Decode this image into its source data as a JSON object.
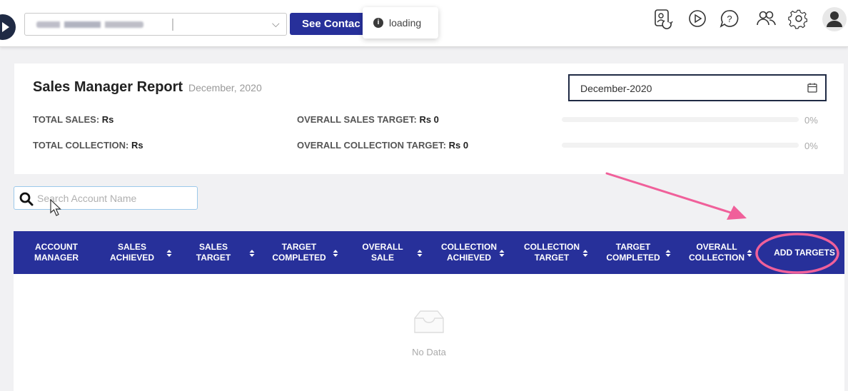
{
  "topbar": {
    "account_select": {
      "value_obscured": true
    },
    "see_button_label": "See Contac",
    "toast_text": "loading",
    "icons": [
      "refresh-contact-icon",
      "play-circle-icon",
      "help-chat-icon",
      "users-icon",
      "gear-icon",
      "user-avatar-icon"
    ]
  },
  "report": {
    "title": "Sales Manager Report",
    "subtitle": "December, 2020",
    "month_value": "December-2020",
    "stats": [
      {
        "label": "TOTAL SALES",
        "value": "Rs"
      },
      {
        "label": "TOTAL COLLECTION",
        "value": "Rs"
      },
      {
        "label": "OVERALL SALES TARGET",
        "value": "Rs 0",
        "progress": 0,
        "percent": "0%"
      },
      {
        "label": "OVERALL COLLECTION TARGET",
        "value": "Rs 0",
        "progress": 0,
        "percent": "0%"
      }
    ]
  },
  "search": {
    "placeholder": "Search Account Name"
  },
  "table": {
    "columns": [
      {
        "line1": "ACCOUNT",
        "line2": "MANAGER",
        "sortable": false
      },
      {
        "line1": "SALES",
        "line2": "ACHIEVED",
        "sortable": true
      },
      {
        "line1": "SALES",
        "line2": "TARGET",
        "sortable": true
      },
      {
        "line1": "TARGET",
        "line2": "COMPLETED",
        "sortable": true
      },
      {
        "line1": "OVERALL",
        "line2": "SALE",
        "sortable": true
      },
      {
        "line1": "COLLECTION",
        "line2": "ACHIEVED",
        "sortable": true
      },
      {
        "line1": "COLLECTION",
        "line2": "TARGET",
        "sortable": true
      },
      {
        "line1": "TARGET",
        "line2": "COMPLETED",
        "sortable": true
      },
      {
        "line1": "OVERALL",
        "line2": "COLLECTION",
        "sortable": true
      },
      {
        "line1": "ADD TARGETS",
        "line2": "",
        "sortable": false
      }
    ],
    "empty_text": "No Data"
  },
  "colors": {
    "primary": "#27309a",
    "annotation": "#f0609a"
  }
}
